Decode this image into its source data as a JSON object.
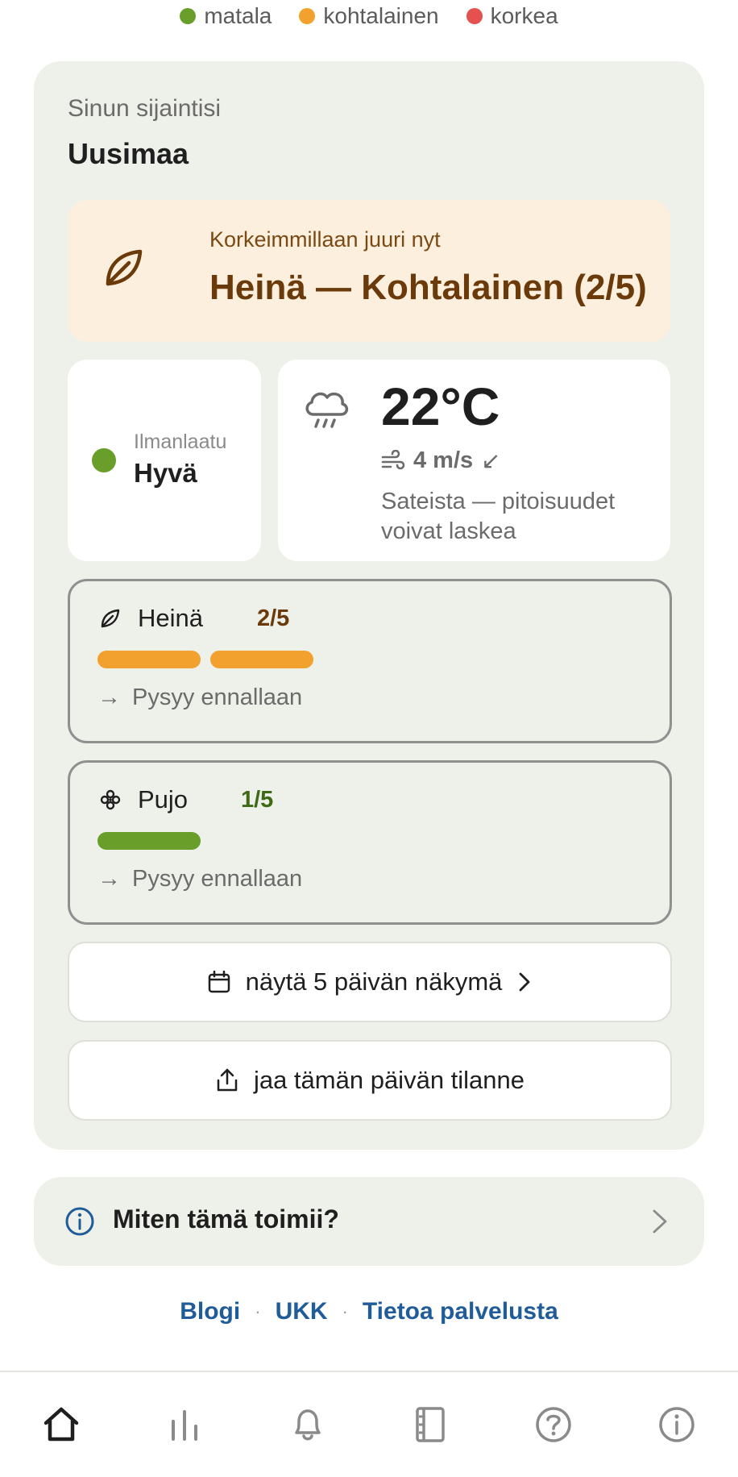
{
  "legend": [
    {
      "label": "matala",
      "color": "#6a9e2a"
    },
    {
      "label": "kohtalainen",
      "color": "#f2a02e"
    },
    {
      "label": "korkea",
      "color": "#e5514f"
    }
  ],
  "location": {
    "label": "Sinun sijaintisi",
    "name": "Uusimaa"
  },
  "peak": {
    "label": "Korkeimmillaan juuri nyt",
    "value": "Heinä — Kohtalainen (2/5)",
    "icon": "leaf-icon"
  },
  "air_quality": {
    "label": "Ilmanlaatu",
    "value": "Hyvä",
    "color": "#6a9e2a"
  },
  "weather": {
    "temp": "22°C",
    "wind": "4 m/s",
    "wind_direction_arrow": "↙",
    "description": "Sateista — pitoisuudet voivat laskea",
    "icon": "rain-cloud-icon"
  },
  "pollens": [
    {
      "name": "Heinä",
      "score": "2/5",
      "level": 2,
      "max": 5,
      "color": "#f2a02e",
      "score_color": "#6b3a0a",
      "trend_arrow": "→",
      "trend": "Pysyy ennallaan",
      "icon": "leaf-icon"
    },
    {
      "name": "Pujo",
      "score": "1/5",
      "level": 1,
      "max": 5,
      "color": "#6a9e2a",
      "score_color": "#3d6b14",
      "trend_arrow": "→",
      "trend": "Pysyy ennallaan",
      "icon": "flower-icon"
    }
  ],
  "actions": {
    "forecast": "näytä 5 päivän näkymä",
    "share": "jaa tämän päivän tilanne"
  },
  "info": {
    "label": "Miten tämä toimii?"
  },
  "footer_links": [
    "Blogi",
    "UKK",
    "Tietoa palvelusta"
  ],
  "nav": [
    "home-icon",
    "chart-icon",
    "bell-icon",
    "book-icon",
    "help-icon",
    "info-icon"
  ]
}
